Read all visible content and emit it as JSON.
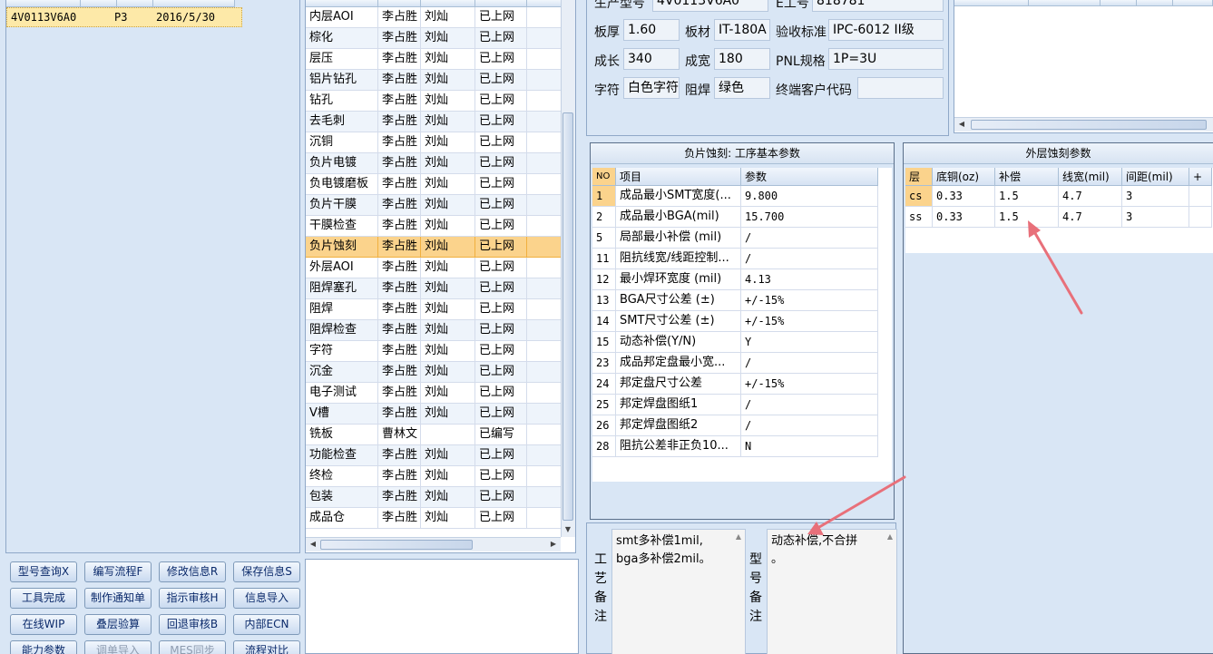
{
  "left_list": {
    "selected_row": {
      "model": "4V0113V6A0",
      "layers": "P3",
      "date": "2016/5/30"
    }
  },
  "buttons": [
    {
      "label": "型号查询X",
      "disabled": false
    },
    {
      "label": "编写流程F",
      "disabled": false
    },
    {
      "label": "修改信息R",
      "disabled": false
    },
    {
      "label": "保存信息S",
      "disabled": false
    },
    {
      "label": "工具完成",
      "disabled": false
    },
    {
      "label": "制作通知单",
      "disabled": false
    },
    {
      "label": "指示审核H",
      "disabled": false
    },
    {
      "label": "信息导入",
      "disabled": false
    },
    {
      "label": "在线WIP",
      "disabled": false
    },
    {
      "label": "叠层验算",
      "disabled": false
    },
    {
      "label": "回退审核B",
      "disabled": false
    },
    {
      "label": "内部ECN",
      "disabled": false
    },
    {
      "label": "能力参数",
      "disabled": false
    },
    {
      "label": "调单导入",
      "disabled": true
    },
    {
      "label": "MES同步",
      "disabled": true
    },
    {
      "label": "流程对比",
      "disabled": false
    }
  ],
  "process_grid": {
    "rows": [
      {
        "name": "内层AOI",
        "code": "李占胜",
        "audit": "刘灿",
        "status": "已上网"
      },
      {
        "name": "棕化",
        "code": "李占胜",
        "audit": "刘灿",
        "status": "已上网"
      },
      {
        "name": "层压",
        "code": "李占胜",
        "audit": "刘灿",
        "status": "已上网"
      },
      {
        "name": "铝片钻孔",
        "code": "李占胜",
        "audit": "刘灿",
        "status": "已上网"
      },
      {
        "name": "钻孔",
        "code": "李占胜",
        "audit": "刘灿",
        "status": "已上网"
      },
      {
        "name": "去毛刺",
        "code": "李占胜",
        "audit": "刘灿",
        "status": "已上网"
      },
      {
        "name": "沉铜",
        "code": "李占胜",
        "audit": "刘灿",
        "status": "已上网"
      },
      {
        "name": "负片电镀",
        "code": "李占胜",
        "audit": "刘灿",
        "status": "已上网"
      },
      {
        "name": "负电镀磨板",
        "code": "李占胜",
        "audit": "刘灿",
        "status": "已上网"
      },
      {
        "name": "负片干膜",
        "code": "李占胜",
        "audit": "刘灿",
        "status": "已上网"
      },
      {
        "name": "干膜检查",
        "code": "李占胜",
        "audit": "刘灿",
        "status": "已上网"
      },
      {
        "name": "负片蚀刻",
        "code": "李占胜",
        "audit": "刘灿",
        "status": "已上网",
        "selected": true
      },
      {
        "name": "外层AOI",
        "code": "李占胜",
        "audit": "刘灿",
        "status": "已上网"
      },
      {
        "name": "阻焊塞孔",
        "code": "李占胜",
        "audit": "刘灿",
        "status": "已上网"
      },
      {
        "name": "阻焊",
        "code": "李占胜",
        "audit": "刘灿",
        "status": "已上网"
      },
      {
        "name": "阻焊检查",
        "code": "李占胜",
        "audit": "刘灿",
        "status": "已上网"
      },
      {
        "name": "字符",
        "code": "李占胜",
        "audit": "刘灿",
        "status": "已上网"
      },
      {
        "name": "沉金",
        "code": "李占胜",
        "audit": "刘灿",
        "status": "已上网"
      },
      {
        "name": "电子测试",
        "code": "李占胜",
        "audit": "刘灿",
        "status": "已上网"
      },
      {
        "name": "V槽",
        "code": "李占胜",
        "audit": "刘灿",
        "status": "已上网"
      },
      {
        "name": "铣板",
        "code": "曹林文",
        "audit": "",
        "status": "已编写"
      },
      {
        "name": "功能检查",
        "code": "李占胜",
        "audit": "刘灿",
        "status": "已上网"
      },
      {
        "name": "终检",
        "code": "李占胜",
        "audit": "刘灿",
        "status": "已上网"
      },
      {
        "name": "包装",
        "code": "李占胜",
        "audit": "刘灿",
        "status": "已上网"
      },
      {
        "name": "成品仓",
        "code": "李占胜",
        "audit": "刘灿",
        "status": "已上网"
      }
    ]
  },
  "info": {
    "prod_model_label": "生产型号",
    "prod_model_value": "4V0113V6A0",
    "e_no_label": "E工号",
    "e_no_value": "818781",
    "thickness_label": "板厚",
    "thickness_value": "1.60",
    "material_label": "板材",
    "material_value": "IT-180A",
    "standard_label": "验收标准",
    "standard_value": "IPC-6012 II级",
    "length_label": "成长",
    "length_value": "340",
    "width_label": "成宽",
    "width_value": "180",
    "pnl_label": "PNL规格",
    "pnl_value": "1P=3U",
    "char_label": "字符",
    "char_value": "白色字符",
    "mask_label": "阻焊",
    "mask_value": "绿色",
    "cust_label": "终端客户代码",
    "cust_value": ""
  },
  "neg_etch": {
    "title": "负片蚀刻: 工序基本参数",
    "headers": {
      "no": "NO",
      "item": "项目",
      "param": "参数"
    },
    "rows": [
      {
        "no": "1",
        "item": "成品最小SMT宽度(...",
        "param": "9.800"
      },
      {
        "no": "2",
        "item": "成品最小BGA(mil)",
        "param": "15.700"
      },
      {
        "no": "5",
        "item": "局部最小补偿 (mil)",
        "param": "/"
      },
      {
        "no": "11",
        "item": "阻抗线宽/线距控制...",
        "param": "/"
      },
      {
        "no": "12",
        "item": "最小焊环宽度 (mil)",
        "param": "4.13"
      },
      {
        "no": "13",
        "item": "BGA尺寸公差 (±)",
        "param": "+/-15%"
      },
      {
        "no": "14",
        "item": "SMT尺寸公差 (±)",
        "param": "+/-15%"
      },
      {
        "no": "15",
        "item": "动态补偿(Y/N)",
        "param": "Y"
      },
      {
        "no": "23",
        "item": "成品邦定盘最小宽...",
        "param": "/"
      },
      {
        "no": "24",
        "item": "邦定盘尺寸公差",
        "param": "+/-15%"
      },
      {
        "no": "25",
        "item": "邦定焊盘图纸1",
        "param": "/"
      },
      {
        "no": "26",
        "item": "邦定焊盘图纸2",
        "param": "/"
      },
      {
        "no": "28",
        "item": "阻抗公差非正负10...",
        "param": "N"
      }
    ]
  },
  "outer_etch": {
    "title": "外层蚀刻参数",
    "headers": {
      "layer": "层",
      "base_cu": "底铜(oz)",
      "comp": "补偿",
      "width": "线宽(mil)",
      "space": "间距(mil)",
      "plus": "+"
    },
    "rows": [
      {
        "layer": "cs",
        "base_cu": "0.33",
        "comp": "1.5",
        "width": "4.7",
        "space": "3"
      },
      {
        "layer": "ss",
        "base_cu": "0.33",
        "comp": "1.5",
        "width": "4.7",
        "space": "3"
      }
    ]
  },
  "remarks": {
    "process_label": "工艺备注",
    "process_text": "smt多补偿1mil,\nbga多补偿2mil。",
    "model_label": "型号备注",
    "model_text": "动态补偿,不合拼\n。"
  },
  "colors": {
    "selected_row": "#fbd38c",
    "arrow": "#e8707a",
    "panel_bg": "#d9e6f5"
  }
}
